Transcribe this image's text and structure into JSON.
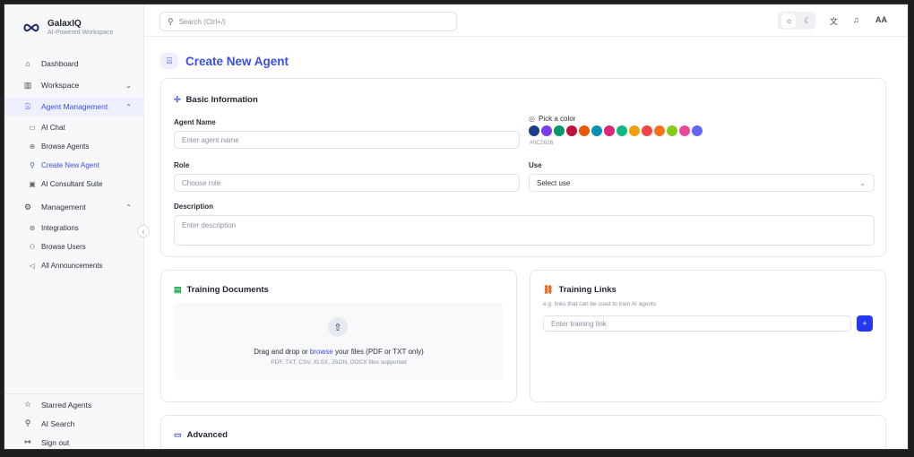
{
  "brand": {
    "name": "GalaxIQ",
    "tagline": "AI-Powered Workspace"
  },
  "sidebar": {
    "dashboard": "Dashboard",
    "workspace": "Workspace",
    "agent_management": "Agent Management",
    "agent_sub": [
      "AI Chat",
      "Browse Agents",
      "Create New Agent",
      "AI Consultant Suite"
    ],
    "management": "Management",
    "management_sub": [
      "Integrations",
      "Browse Users",
      "All Announcements"
    ],
    "bottom": [
      "Starred Agents",
      "AI Search",
      "Sign out"
    ]
  },
  "topbar": {
    "search_placeholder": "Search (Ctrl+/)",
    "translate_label": "AA"
  },
  "page": {
    "title": "Create New Agent"
  },
  "basic": {
    "title": "Basic Information",
    "agent_name_label": "Agent Name",
    "agent_name_placeholder": "Enter agent name",
    "pick_color_label": "Pick a color",
    "selected_hex": "#0C2626",
    "role_label": "Role",
    "role_placeholder": "Choose role",
    "use_label": "Use",
    "use_value": "Select use",
    "description_label": "Description",
    "description_placeholder": "Enter description"
  },
  "colors": [
    "#1e3a8a",
    "#7c3aed",
    "#059669",
    "#be123c",
    "#ea580c",
    "#0891b2",
    "#db2777",
    "#10b981",
    "#f59e0b",
    "#ef4444",
    "#f97316",
    "#84cc16",
    "#ec4899",
    "#6366f1"
  ],
  "training_docs": {
    "title": "Training Documents",
    "drop_prefix": "Drag and drop or ",
    "drop_link": "browse",
    "drop_suffix": " your files (PDF or TXT only)",
    "supported": "PDF, TXT, CSV, XLSX, JSON, DOCX files supported"
  },
  "training_links": {
    "title": "Training Links",
    "hint": "e.g. links that can be used to train AI agents",
    "placeholder": "Enter training link",
    "add_label": "+"
  },
  "advanced": {
    "title": "Advanced"
  },
  "accent_color": "#3b4fe4"
}
